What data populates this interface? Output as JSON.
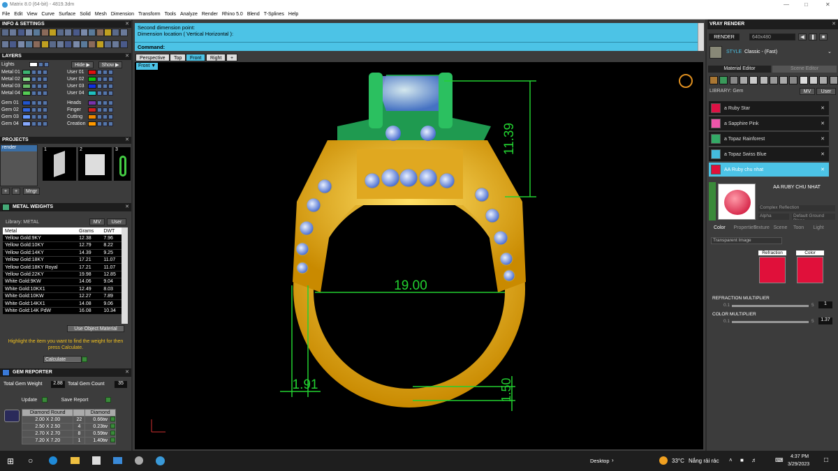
{
  "window": {
    "title": "Matrix 8.0 (64-bit) - 4819.3dm"
  },
  "menu": [
    "File",
    "Edit",
    "View",
    "Curve",
    "Surface",
    "Solid",
    "Mesh",
    "Dimension",
    "Transform",
    "Tools",
    "Analyze",
    "Render",
    "Rhino 5.0",
    "Blend",
    "T-Splines",
    "Help"
  ],
  "info_panel": {
    "title": "INFO & SETTINGS"
  },
  "layers": {
    "title": "LAYERS",
    "lights": "Lights",
    "hide": "Hide",
    "show": "Show",
    "left": [
      {
        "name": "Metal 01",
        "color": "#3cb371"
      },
      {
        "name": "Metal 02",
        "color": "#88dd88"
      },
      {
        "name": "Metal 03",
        "color": "#66bb66"
      },
      {
        "name": "Metal 04",
        "color": "#55cc55"
      },
      {
        "name": "Gem 01",
        "color": "#2255cc"
      },
      {
        "name": "Gem 02",
        "color": "#3366dd"
      },
      {
        "name": "Gem 03",
        "color": "#6699ff"
      },
      {
        "name": "Gem 04",
        "color": "#88aaff"
      }
    ],
    "right": [
      {
        "name": "User 01",
        "color": "#e01010"
      },
      {
        "name": "User 02",
        "color": "#10c010"
      },
      {
        "name": "User 03",
        "color": "#1030e0"
      },
      {
        "name": "User 04",
        "color": "#20c0c0"
      },
      {
        "name": "Heads",
        "color": "#7733aa"
      },
      {
        "name": "Finger",
        "color": "#cc2222"
      },
      {
        "name": "Cutting",
        "color": "#ee8800"
      },
      {
        "name": "Creation",
        "color": "#ff9900"
      }
    ]
  },
  "projects": {
    "title": "PROJECTS",
    "item": "render",
    "thumbs": [
      "1",
      "2",
      "3"
    ],
    "manager": "Mngr"
  },
  "metal_weights": {
    "title": "METAL WEIGHTS",
    "library": "Library: METAL",
    "mv": "MV",
    "user": "User",
    "headers": [
      "Metal",
      "Grams",
      "DWT"
    ],
    "rows": [
      [
        "Yellow Gold:9KY",
        "12.38",
        "7.96"
      ],
      [
        "Yellow Gold:10KY",
        "12.79",
        "8.22"
      ],
      [
        "Yellow Gold:14KY",
        "14.39",
        "9.25"
      ],
      [
        "Yellow Gold:18KY",
        "17.21",
        "11.07"
      ],
      [
        "Yellow Gold:18KY Royal",
        "17.21",
        "11.07"
      ],
      [
        "Yellow Gold:22KY",
        "19.98",
        "12.85"
      ],
      [
        "White Gold:9KW",
        "14.06",
        "9.04"
      ],
      [
        "White Gold:10KX1",
        "12.49",
        "8.03"
      ],
      [
        "White Gold:10KW",
        "12.27",
        "7.89"
      ],
      [
        "White Gold:14KX1",
        "14.08",
        "9.06"
      ],
      [
        "White Gold:14K PdW",
        "16.08",
        "10.34"
      ]
    ],
    "use_object": "Use Object Material",
    "hint": "Highlight the item you want to find the weight for then press Calculate.",
    "calculate": "Calculate"
  },
  "gem_reporter": {
    "title": "GEM REPORTER",
    "total_weight_label": "Total Gem Weight",
    "total_weight": "2.88",
    "total_count_label": "Total Gem Count",
    "total_count": "35",
    "update": "Update",
    "save": "Save Report",
    "headers": [
      "Diamond Round",
      "",
      "Diamond"
    ],
    "rows": [
      [
        "2.00 X 2.00",
        "22",
        "0.66tw"
      ],
      [
        "2.50 X 2.50",
        "4",
        "0.23tw"
      ],
      [
        "2.70 X 2.70",
        "8",
        "0.59tw"
      ],
      [
        "7.20 X 7.20",
        "1",
        "1.40tw"
      ]
    ]
  },
  "command": {
    "line1": "Second dimension point:",
    "line2": "Dimension location ( Vertical  Horizontal ):",
    "label": "Command:"
  },
  "viewport_tabs": [
    "Perspective",
    "Top",
    "Front",
    "Right",
    "+"
  ],
  "viewport_label": "Front",
  "dimensions": {
    "height": "11.39",
    "inner": "19.00",
    "shank": "1.91",
    "bottom": "1.50"
  },
  "vray": {
    "title": "VRAY RENDER",
    "render": "RENDER",
    "size": "640x480",
    "style_label": "STYLE",
    "style": "Classic - (Fast)",
    "tab_material": "Material Editor",
    "tab_scene": "Scene Editor",
    "library": "LIBRARY: Gem",
    "mv": "MV",
    "user": "User",
    "materials": [
      {
        "name": "a Ruby Star",
        "color": "#dd1144"
      },
      {
        "name": "a Sapphire Pink",
        "color": "#ee55aa"
      },
      {
        "name": "a Topaz Rainforest",
        "color": "#33aa66"
      },
      {
        "name": "a Topaz Swiss Blue",
        "color": "#44bbdd"
      },
      {
        "name": "AA Ruby chu nhat",
        "color": "#e0103a"
      }
    ],
    "selected_name": "AA RUBY CHU NHAT",
    "reflection": "Complex Reflection",
    "alpha": "Alpha",
    "ground": "Default Ground Plane",
    "sub_tabs": [
      "Color",
      "Properties",
      "Texture",
      "Scene",
      "Toon",
      "Light"
    ],
    "transparent": "Transparent Image",
    "refraction": "Refraction",
    "color": "Color",
    "refraction_mult": "REFRACTION MULTIPLIER",
    "color_mult": "COLOR MULTIPLIER",
    "rm_min": "0.1",
    "rm_max": "5",
    "rm_val": "1",
    "cm_min": "0.1",
    "cm_max": "5",
    "cm_val": "1.37"
  },
  "taskbar": {
    "desktop": "Desktop",
    "temp": "33°C",
    "weather": "Nắng rải rác",
    "time": "4:37 PM",
    "date": "3/29/2023"
  }
}
